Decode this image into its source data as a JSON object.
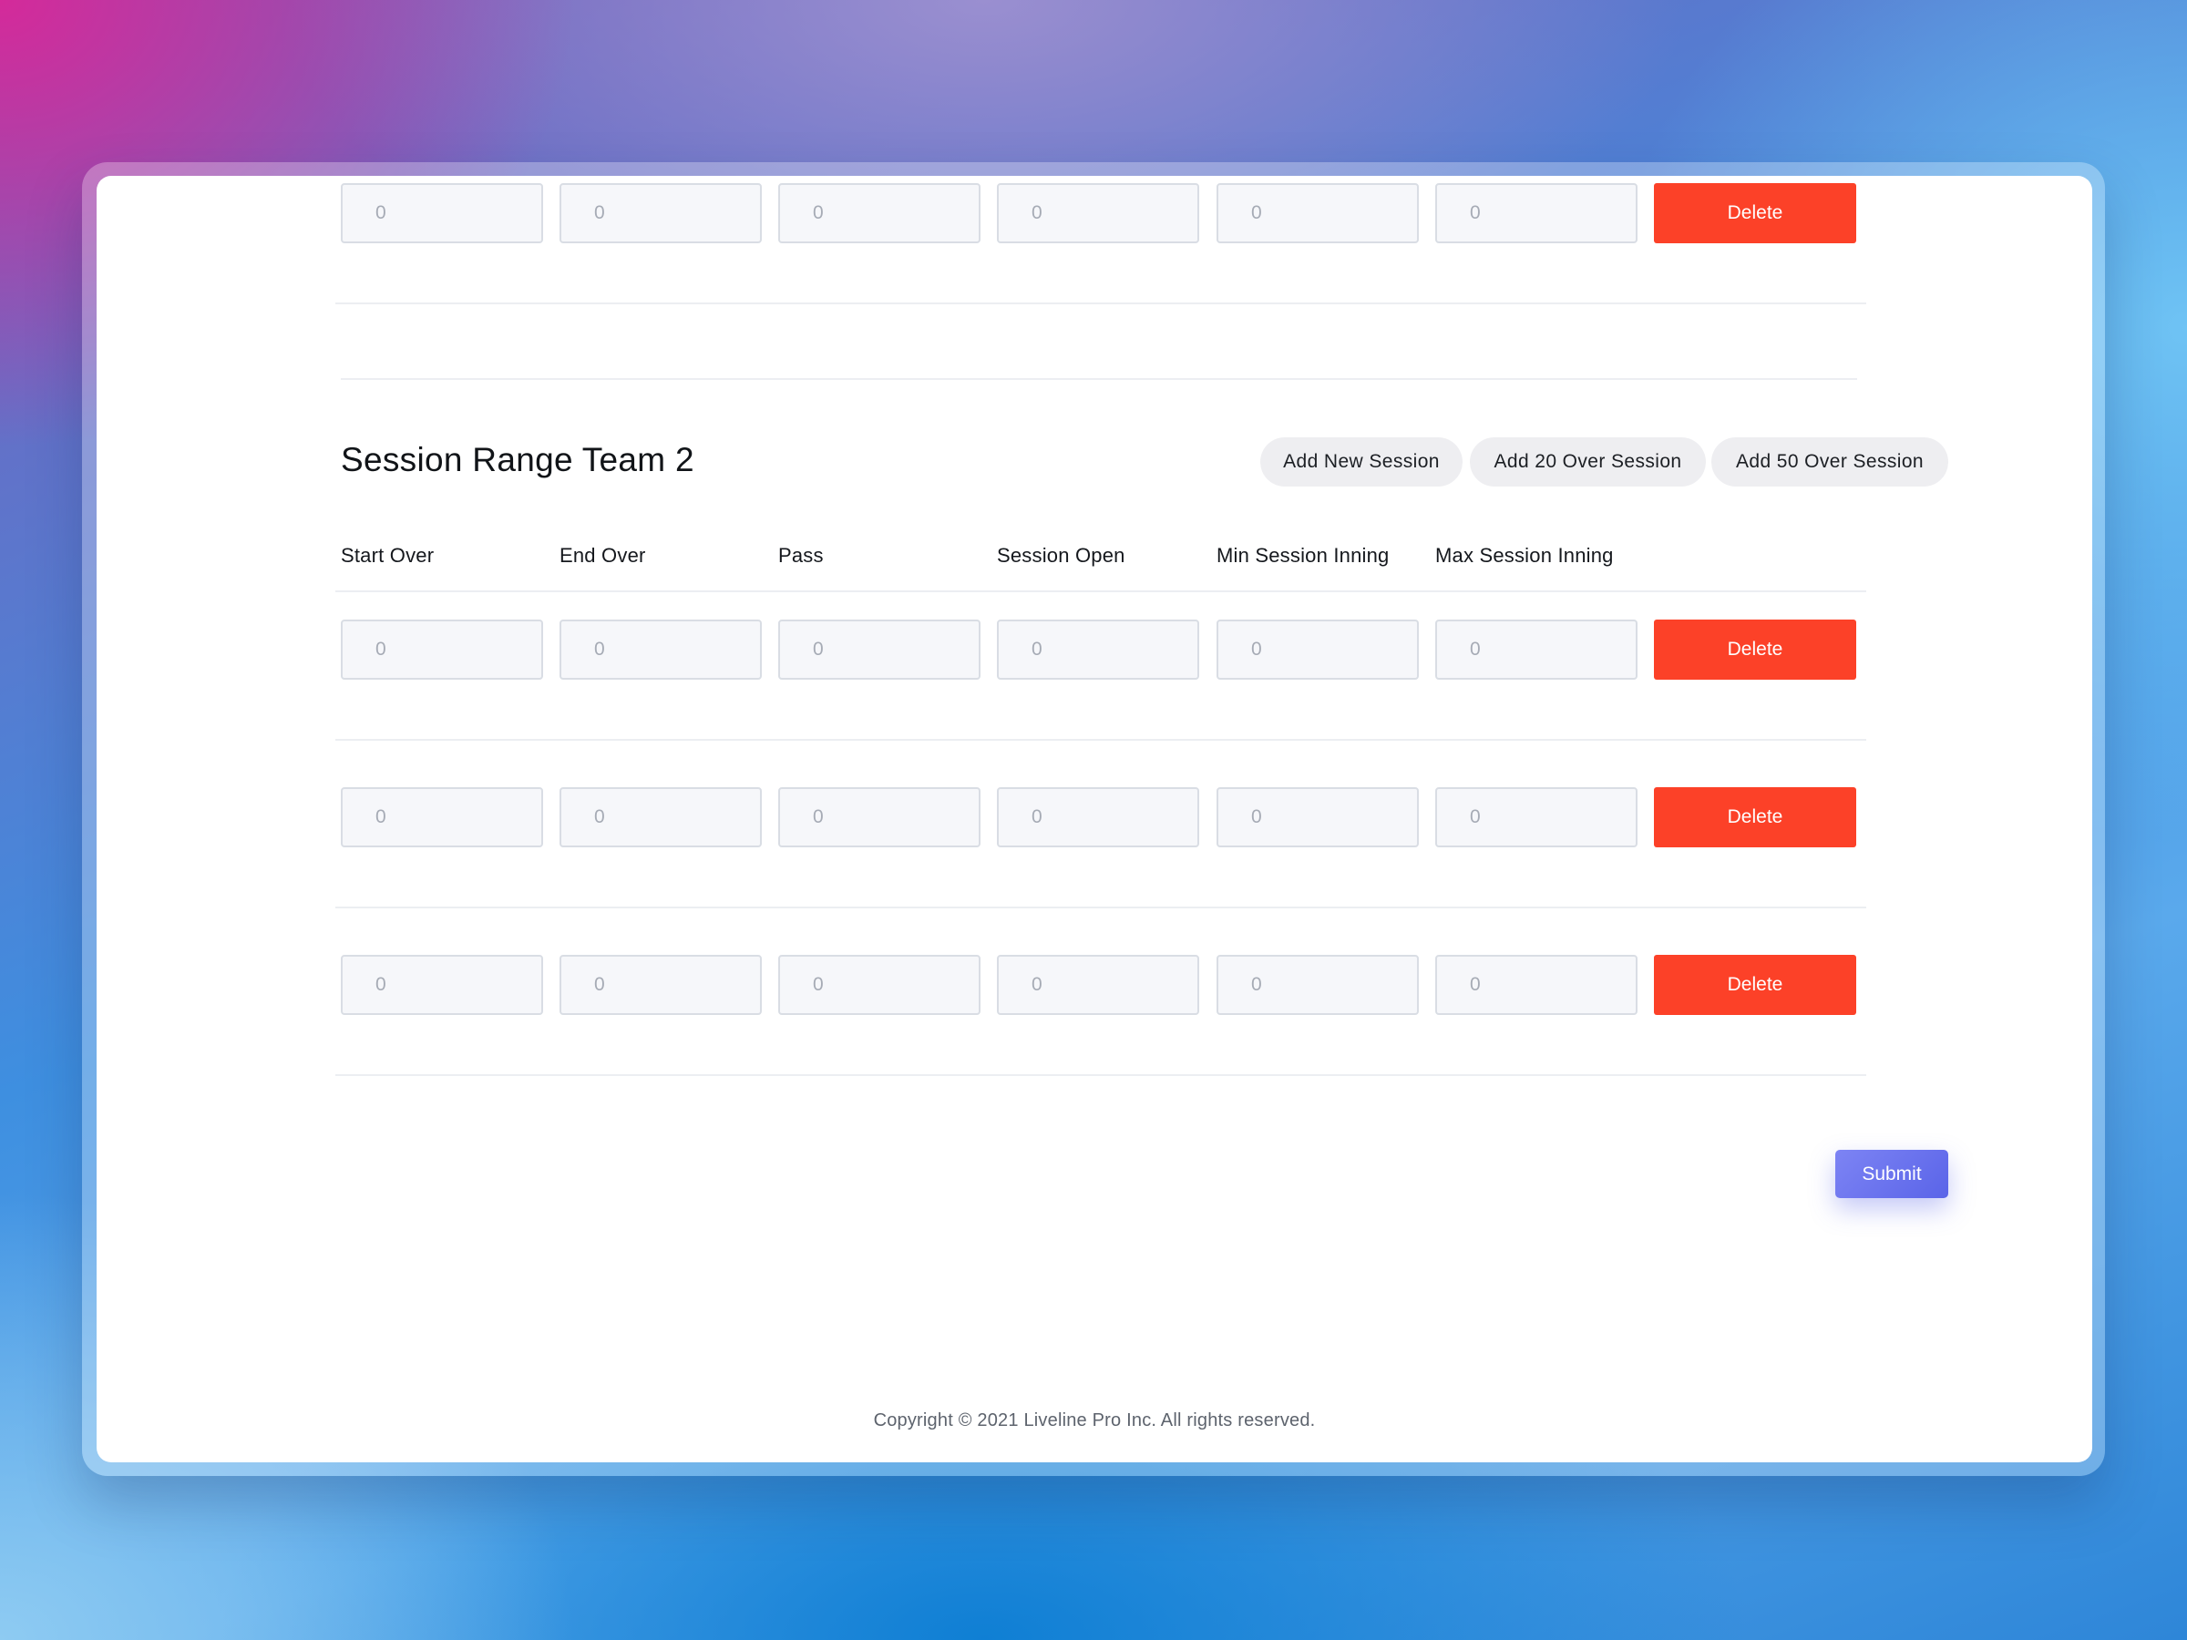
{
  "top_row": {
    "fields": [
      "0",
      "0",
      "0",
      "0",
      "0",
      "0"
    ],
    "delete_label": "Delete"
  },
  "section": {
    "title": "Session Range Team 2",
    "actions": {
      "add_new": "Add New Session",
      "add_20": "Add 20 Over Session",
      "add_50": "Add 50 Over Session"
    },
    "columns": [
      "Start Over",
      "End Over",
      "Pass",
      "Session Open",
      "Min Session Inning",
      "Max Session Inning"
    ],
    "rows": [
      {
        "fields": [
          "0",
          "0",
          "0",
          "0",
          "0",
          "0"
        ],
        "delete_label": "Delete"
      },
      {
        "fields": [
          "0",
          "0",
          "0",
          "0",
          "0",
          "0"
        ],
        "delete_label": "Delete"
      },
      {
        "fields": [
          "0",
          "0",
          "0",
          "0",
          "0",
          "0"
        ],
        "delete_label": "Delete"
      }
    ]
  },
  "submit_label": "Submit",
  "footer": {
    "copyright": "Copyright © 2021 Liveline Pro Inc. All rights reserved."
  },
  "colors": {
    "delete": "#fc4128",
    "submit": "#6670ee",
    "pill_bg": "#eeeef1",
    "input_bg": "#f6f7fa"
  }
}
